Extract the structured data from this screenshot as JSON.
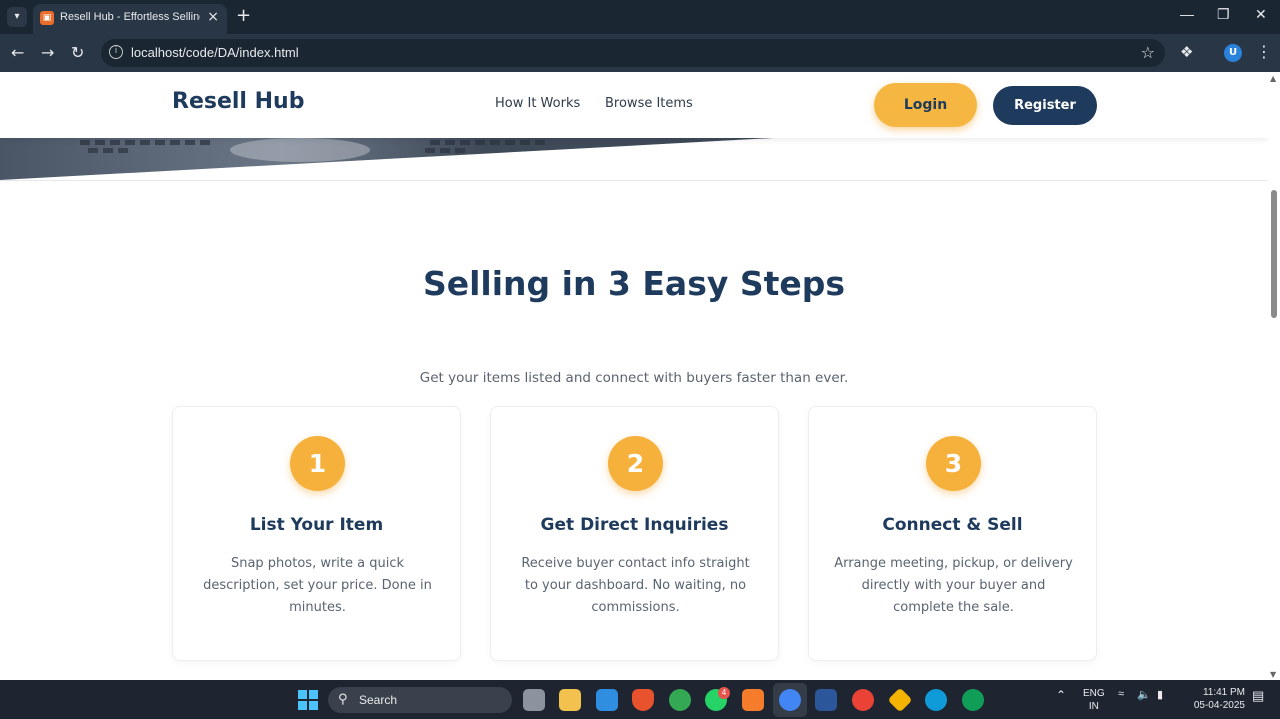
{
  "browser": {
    "tab_title": "Resell Hub - Effortless Selling, D",
    "url": "localhost/code/DA/index.html",
    "profile_initial": "U"
  },
  "site": {
    "logo": "Resell Hub",
    "nav": [
      "How It Works",
      "Browse Items"
    ],
    "login_label": "Login",
    "register_label": "Register"
  },
  "section": {
    "title": "Selling in 3 Easy Steps",
    "subtitle": "Get your items listed and connect with buyers faster than ever."
  },
  "steps": [
    {
      "number": "1",
      "title": "List Your Item",
      "text": "Snap photos, write a quick description, set your price. Done in minutes."
    },
    {
      "number": "2",
      "title": "Get Direct Inquiries",
      "text": "Receive buyer contact info straight to your dashboard. No waiting, no commissions."
    },
    {
      "number": "3",
      "title": "Connect & Sell",
      "text": "Arrange meeting, pickup, or delivery directly with your buyer and complete the sale."
    }
  ],
  "taskbar": {
    "search_label": "Search",
    "whatsapp_badge": "4",
    "language": "ENG",
    "region": "IN",
    "time": "11:41 PM",
    "date": "05-04-2025"
  },
  "colors": {
    "brand_navy": "#1e3a5c",
    "accent_orange": "#f6b13d"
  }
}
